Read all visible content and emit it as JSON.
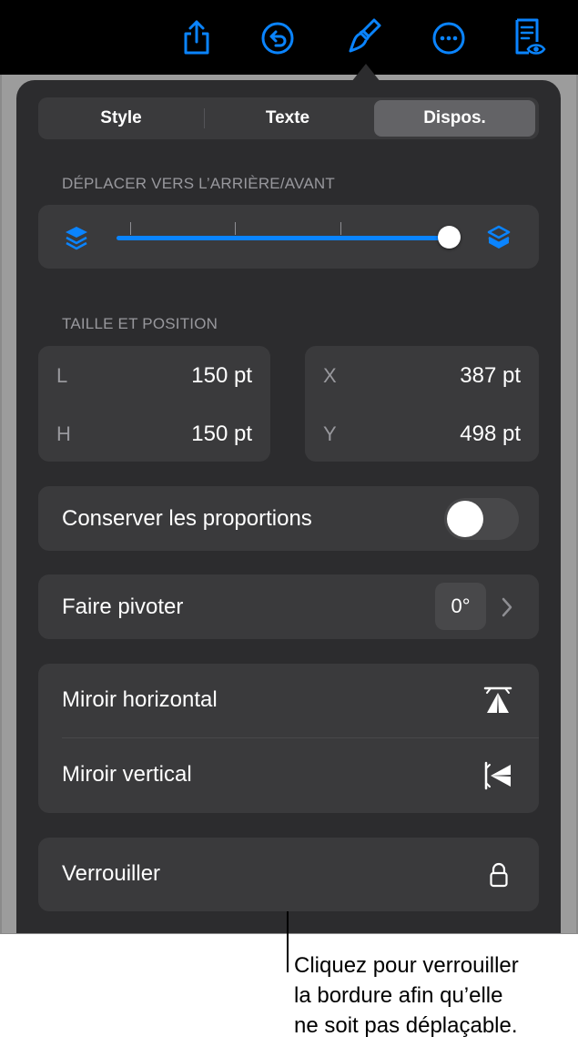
{
  "toolbar": {
    "icons": [
      "share-icon",
      "undo-icon",
      "format-brush-icon",
      "more-icon",
      "reader-view-icon"
    ],
    "accent_color": "#0a84ff"
  },
  "segmented": {
    "tabs": [
      "Style",
      "Texte",
      "Dispos."
    ],
    "selected": "Dispos."
  },
  "arrange": {
    "header": "DÉPLACER VERS L’ARRIÈRE/AVANT",
    "slider_value": 1.0,
    "slider_ticks": 4,
    "back_icon": "layers-back-icon",
    "front_icon": "layers-front-icon"
  },
  "size_position": {
    "header": "TAILLE ET POSITION",
    "width_label": "L",
    "width_value": "150 pt",
    "height_label": "H",
    "height_value": "150 pt",
    "x_label": "X",
    "x_value": "387 pt",
    "y_label": "Y",
    "y_value": "498 pt"
  },
  "constrain": {
    "label": "Conserver les proportions",
    "on": false
  },
  "rotate": {
    "label": "Faire pivoter",
    "value": "0°"
  },
  "flip": {
    "horizontal_label": "Miroir horizontal",
    "vertical_label": "Miroir vertical"
  },
  "lock": {
    "label": "Verrouiller"
  },
  "callout": {
    "lines": [
      "Cliquez pour verrouiller",
      "la bordure afin qu’elle",
      "ne soit pas déplaçable."
    ]
  }
}
